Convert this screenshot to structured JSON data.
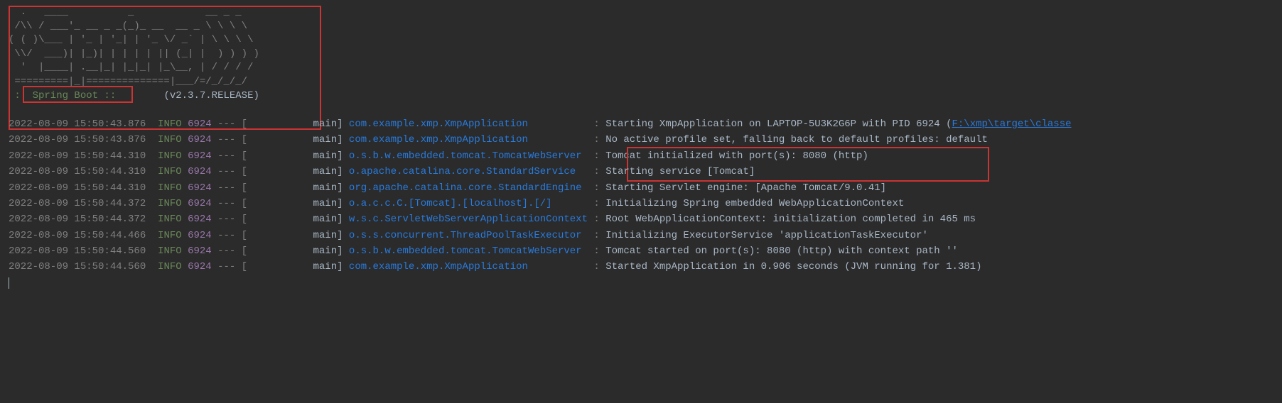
{
  "banner": {
    "lines": [
      "  .   ____          _            __ _ _",
      " /\\\\ / ___'_ __ _ _(_)_ __  __ _ \\ \\ \\ \\",
      "( ( )\\___ | '_ | '_| | '_ \\/ _` | \\ \\ \\ \\",
      " \\\\/  ___)| |_)| | | | | || (_| |  ) ) ) )",
      "  '  |____| .__|_| |_|_| |_\\__, | / / / /",
      " =========|_|==============|___/=/_/_/_/"
    ],
    "label": " :: Spring Boot :: ",
    "version": "       (v2.3.7.RELEASE)"
  },
  "logs": [
    {
      "ts": "2022-08-09 15:50:43.876",
      "level": "INFO",
      "pid": "6924",
      "sep": " --- [",
      "thread": "           main] ",
      "logger": "com.example.xmp.XmpApplication          ",
      "colon": " : ",
      "msg": "Starting XmpApplication on LAPTOP-5U3K2G6P with PID 6924 (",
      "link": "F:\\xmp\\target\\classe"
    },
    {
      "ts": "2022-08-09 15:50:43.876",
      "level": "INFO",
      "pid": "6924",
      "sep": " --- [",
      "thread": "           main] ",
      "logger": "com.example.xmp.XmpApplication          ",
      "colon": " : ",
      "msg": "No active profile set, falling back to default profiles: default"
    },
    {
      "ts": "2022-08-09 15:50:44.310",
      "level": "INFO",
      "pid": "6924",
      "sep": " --- [",
      "thread": "           main] ",
      "logger": "o.s.b.w.embedded.tomcat.TomcatWebServer ",
      "colon": " : ",
      "msg": "Tomcat initialized with port(s): 8080 (http)"
    },
    {
      "ts": "2022-08-09 15:50:44.310",
      "level": "INFO",
      "pid": "6924",
      "sep": " --- [",
      "thread": "           main] ",
      "logger": "o.apache.catalina.core.StandardService  ",
      "colon": " : ",
      "msg": "Starting service [Tomcat]"
    },
    {
      "ts": "2022-08-09 15:50:44.310",
      "level": "INFO",
      "pid": "6924",
      "sep": " --- [",
      "thread": "           main] ",
      "logger": "org.apache.catalina.core.StandardEngine ",
      "colon": " : ",
      "msg": "Starting Servlet engine: [Apache Tomcat/9.0.41]"
    },
    {
      "ts": "2022-08-09 15:50:44.372",
      "level": "INFO",
      "pid": "6924",
      "sep": " --- [",
      "thread": "           main] ",
      "logger": "o.a.c.c.C.[Tomcat].[localhost].[/]      ",
      "colon": " : ",
      "msg": "Initializing Spring embedded WebApplicationContext"
    },
    {
      "ts": "2022-08-09 15:50:44.372",
      "level": "INFO",
      "pid": "6924",
      "sep": " --- [",
      "thread": "           main] ",
      "logger": "w.s.c.ServletWebServerApplicationContext",
      "colon": " : ",
      "msg": "Root WebApplicationContext: initialization completed in 465 ms"
    },
    {
      "ts": "2022-08-09 15:50:44.466",
      "level": "INFO",
      "pid": "6924",
      "sep": " --- [",
      "thread": "           main] ",
      "logger": "o.s.s.concurrent.ThreadPoolTaskExecutor ",
      "colon": " : ",
      "msg": "Initializing ExecutorService 'applicationTaskExecutor'"
    },
    {
      "ts": "2022-08-09 15:50:44.560",
      "level": "INFO",
      "pid": "6924",
      "sep": " --- [",
      "thread": "           main] ",
      "logger": "o.s.b.w.embedded.tomcat.TomcatWebServer ",
      "colon": " : ",
      "msg": "Tomcat started on port(s): 8080 (http) with context path ''"
    },
    {
      "ts": "2022-08-09 15:50:44.560",
      "level": "INFO",
      "pid": "6924",
      "sep": " --- [",
      "thread": "           main] ",
      "logger": "com.example.xmp.XmpApplication          ",
      "colon": " : ",
      "msg": "Started XmpApplication in 0.906 seconds (JVM running for 1.381)"
    }
  ]
}
